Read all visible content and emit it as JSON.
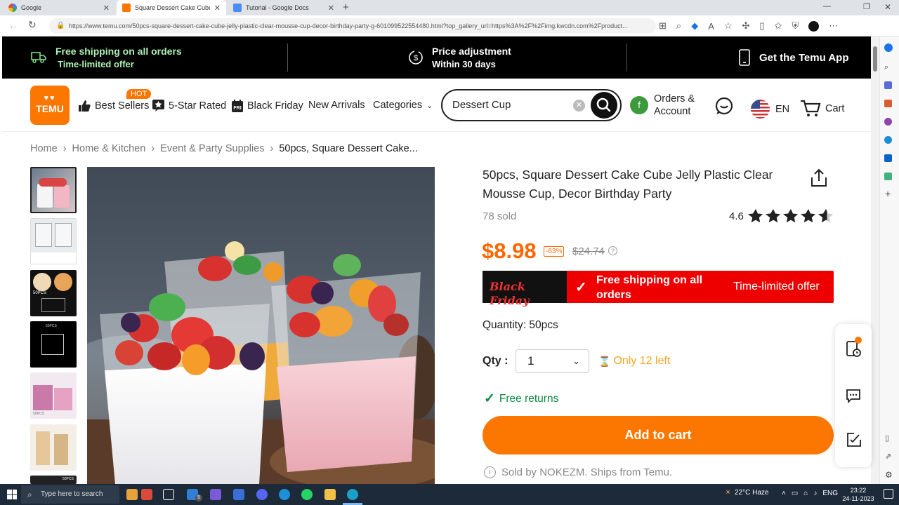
{
  "browser": {
    "tabs": [
      {
        "label": "Google",
        "active": false
      },
      {
        "label": "Square Dessert Cake Cube Jelly P",
        "active": true
      },
      {
        "label": "Tutorial - Google Docs",
        "active": false
      }
    ],
    "url": "https://www.temu.com/50pcs-square-dessert-cake-cube-jelly-plastic-clear-mousse-cup-decor-birthday-party-g-601099522554480.html?top_gallery_url=https%3A%2F%2Fimg.kwcdn.com%2Fproduct..."
  },
  "promo": {
    "shipping_title": "Free shipping on all orders",
    "shipping_sub": "Time-limited offer",
    "price_title": "Price adjustment",
    "price_sub": "Within 30 days",
    "app": "Get the Temu App"
  },
  "header": {
    "logo_line1": "♥♥",
    "logo_line2": "TEMU",
    "nav": {
      "best_sellers": "Best Sellers",
      "hot": "HOT",
      "five_star": "5-Star Rated",
      "black_friday": "Black Friday",
      "new_arrivals": "New Arrivals",
      "categories": "Categories"
    },
    "search_value": "Dessert Cup",
    "orders_line1": "Orders &",
    "orders_line2": "Account",
    "avatar_letter": "f",
    "lang": "EN",
    "cart": "Cart"
  },
  "breadcrumb": {
    "items": [
      "Home",
      "Home & Kitchen",
      "Event & Party Supplies",
      "50pcs, Square Dessert Cake..."
    ]
  },
  "product": {
    "title": "50pcs, Square Dessert Cake Cube Jelly Plastic Clear Mousse Cup, Decor Birthday Party",
    "sold": "78 sold",
    "rating": "4.6",
    "rating_value": 4.6,
    "price": "$8.98",
    "discount": "-63%",
    "original_price": "$24.74",
    "bf_label": "Black Friday",
    "bf_shipping": "Free shipping on all orders",
    "bf_offer": "Time-limited offer",
    "quantity_label": "Quantity: 50pcs",
    "qty_label": "Qty :",
    "qty_value": "1",
    "stock": "Only 12 left",
    "returns": "Free returns",
    "add_to_cart": "Add to cart",
    "sold_by": "Sold by NOKEZM. Ships from Temu.",
    "thumb_labels": [
      "50PCS",
      "50PCS",
      "50PCS",
      "50PCS"
    ]
  },
  "taskbar": {
    "search_placeholder": "Type here to search",
    "weather": "22°C Haze",
    "lang": "ENG",
    "time": "23:22",
    "date": "24-11-2023",
    "badge": "5"
  },
  "colors": {
    "brand": "#fb7701",
    "black_friday": "#e00000",
    "success": "#0a8a3c"
  }
}
